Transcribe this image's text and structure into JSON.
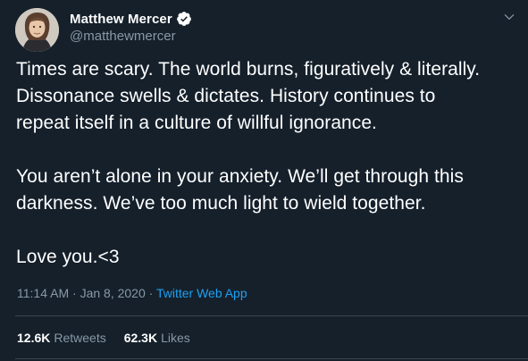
{
  "author": {
    "display_name": "Matthew Mercer",
    "handle": "@matthewmercer",
    "verified": true,
    "avatar_icon": "avatar-portrait"
  },
  "tweet": {
    "paragraphs": [
      "Times are scary. The world burns, figuratively & literally.\nDissonance swells & dictates. History continues to\nrepeat itself in a culture of willful ignorance.",
      "You aren’t alone in your anxiety. We’ll get through this\ndarkness. We’ve too much light to wield together.",
      "Love you.<3"
    ],
    "time": "11:14 AM",
    "date": "Jan 8, 2020",
    "separator": "·",
    "source": "Twitter Web App"
  },
  "stats": {
    "retweets_count": "12.6K",
    "retweets_label": "Retweets",
    "likes_count": "62.3K",
    "likes_label": "Likes"
  },
  "colors": {
    "background": "#15202b",
    "text": "#ffffff",
    "secondary": "#8899a6",
    "accent": "#1da1f2",
    "divider": "#38444d"
  }
}
